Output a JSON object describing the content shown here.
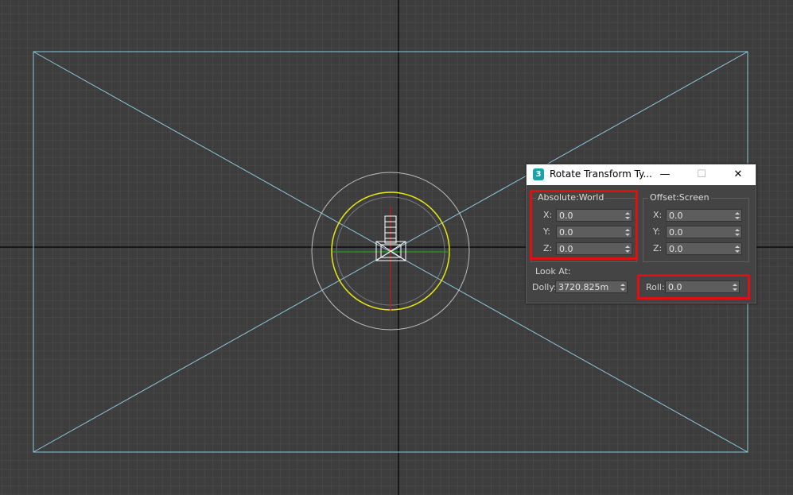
{
  "viewport": {
    "grid_color": "#4e4e4e",
    "axis_color": "#0c0c0c",
    "camera_frustum_color": "#8fc8dc",
    "gizmo_ring_color": "#e8e810",
    "gizmo_outer_ring_color": "#bebebe",
    "x_axis_color": "#1ea01e",
    "y_axis_color": "#c01818"
  },
  "dialog": {
    "title": "Rotate Transform Ty...",
    "app_icon": "3ds-max-icon",
    "minimize_glyph": "—",
    "maximize_glyph": "☐",
    "close_glyph": "✕",
    "absolute": {
      "label": "Absolute:World",
      "x_label": "X:",
      "x_value": "0.0",
      "y_label": "Y:",
      "y_value": "0.0",
      "z_label": "Z:",
      "z_value": "0.0"
    },
    "offset": {
      "label": "Offset:Screen",
      "x_label": "X:",
      "x_value": "0.0",
      "y_label": "Y:",
      "y_value": "0.0",
      "z_label": "Z:",
      "z_value": "0.0"
    },
    "look_at_label": "Look At:",
    "dolly_label": "Dolly:",
    "dolly_value": "3720.825m",
    "roll_label": "Roll:",
    "roll_value": "0.0",
    "highlight_color": "#e01010"
  }
}
